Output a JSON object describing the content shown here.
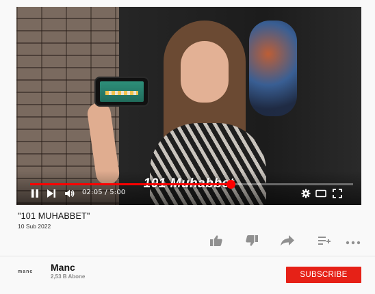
{
  "player": {
    "caption": "101 Muhabbet",
    "progress_fraction": 0.62,
    "time_current": "02:05",
    "time_separator": "/",
    "time_total": "5:00",
    "controls": {
      "pause_icon": "pause-icon",
      "next_icon": "skip-next-icon",
      "volume_icon": "volume-icon",
      "settings_icon": "gear-icon",
      "miniplayer_icon": "theater-mode-icon",
      "fullscreen_icon": "fullscreen-icon"
    }
  },
  "video": {
    "title": "\"101 MUHABBET\"",
    "date": "10 Sub 2022"
  },
  "actions": {
    "icons": [
      "thumbs-up-icon",
      "thumbs-down-icon",
      "share-icon",
      "add-to-playlist-icon",
      "more-icon"
    ],
    "icon_color": "#909090"
  },
  "channel": {
    "logo_text": "manc",
    "name": "Manc",
    "subscribers": "2,53 B Abone"
  },
  "subscribe": {
    "label": "SUBSCRIBE",
    "color": "#e62117"
  }
}
